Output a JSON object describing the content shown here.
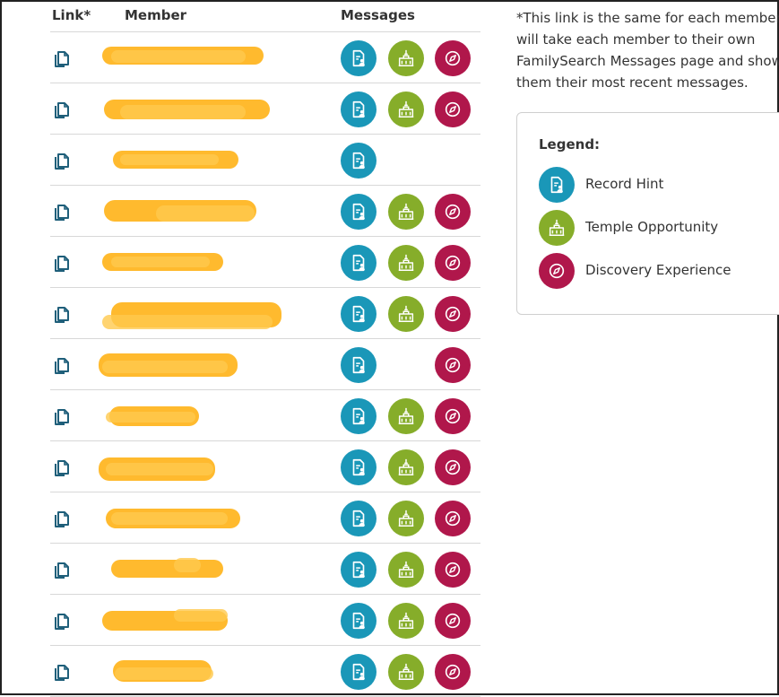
{
  "table": {
    "headers": {
      "link": "Link*",
      "member": "Member",
      "messages": "Messages"
    },
    "rows": [
      {
        "hint": true,
        "temple": true,
        "discovery": true
      },
      {
        "hint": true,
        "temple": true,
        "discovery": true
      },
      {
        "hint": true,
        "temple": false,
        "discovery": false
      },
      {
        "hint": true,
        "temple": true,
        "discovery": true
      },
      {
        "hint": true,
        "temple": true,
        "discovery": true
      },
      {
        "hint": true,
        "temple": true,
        "discovery": true
      },
      {
        "hint": true,
        "temple": false,
        "discovery": true
      },
      {
        "hint": true,
        "temple": true,
        "discovery": true
      },
      {
        "hint": true,
        "temple": true,
        "discovery": true
      },
      {
        "hint": true,
        "temple": true,
        "discovery": true
      },
      {
        "hint": true,
        "temple": true,
        "discovery": true
      },
      {
        "hint": true,
        "temple": true,
        "discovery": true
      },
      {
        "hint": true,
        "temple": true,
        "discovery": true
      }
    ],
    "icons": {
      "link": "copy-icon",
      "hint": "record-hint-icon",
      "temple": "temple-icon",
      "discovery": "compass-icon"
    }
  },
  "note": {
    "line1": "*This link is the same for each member",
    "line2": "will take each member to their own",
    "line3": "FamilySearch Messages page and show",
    "line4": "them their most recent messages."
  },
  "legend": {
    "title": "Legend:",
    "items": [
      {
        "label": "Record Hint",
        "icon": "record-hint-icon",
        "color": "#1a97b8"
      },
      {
        "label": "Temple Opportunity",
        "icon": "temple-icon",
        "color": "#86ad2a"
      },
      {
        "label": "Discovery Experience",
        "icon": "compass-icon",
        "color": "#b0174b"
      }
    ]
  },
  "colors": {
    "hint": "#1a97b8",
    "temple": "#86ad2a",
    "discovery": "#b0174b",
    "redaction": "#ffb317"
  }
}
